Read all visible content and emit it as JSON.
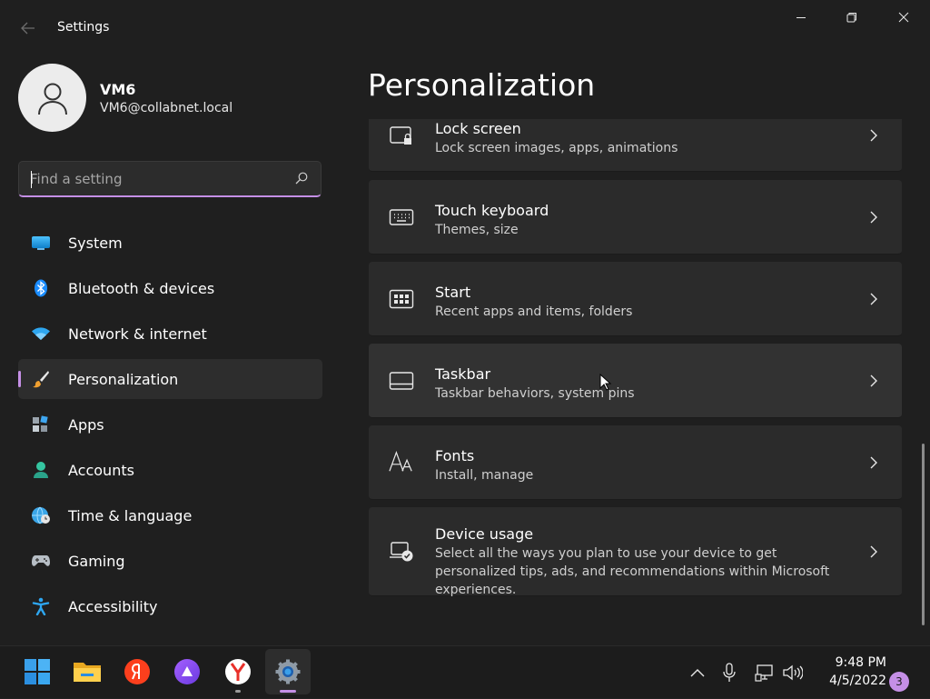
{
  "window": {
    "app_title": "Settings",
    "back_icon": "back-arrow-icon",
    "controls": [
      "minimize-icon",
      "restore-icon",
      "close-icon"
    ]
  },
  "profile": {
    "name": "VM6",
    "email": "VM6@collabnet.local"
  },
  "search": {
    "placeholder": "Find a setting",
    "value": "",
    "accent": "#c58fe6"
  },
  "sidebar": {
    "items": [
      {
        "label": "System",
        "icon": "system-monitor-icon",
        "active": false
      },
      {
        "label": "Bluetooth & devices",
        "icon": "bluetooth-icon",
        "active": false
      },
      {
        "label": "Network & internet",
        "icon": "wifi-icon",
        "active": false
      },
      {
        "label": "Personalization",
        "icon": "paintbrush-icon",
        "active": true
      },
      {
        "label": "Apps",
        "icon": "apps-icon",
        "active": false
      },
      {
        "label": "Accounts",
        "icon": "person-icon",
        "active": false
      },
      {
        "label": "Time & language",
        "icon": "globe-clock-icon",
        "active": false
      },
      {
        "label": "Gaming",
        "icon": "gamepad-icon",
        "active": false
      },
      {
        "label": "Accessibility",
        "icon": "accessibility-icon",
        "active": false
      }
    ]
  },
  "main": {
    "title": "Personalization",
    "cards": [
      {
        "title": "Lock screen",
        "subtitle": "Lock screen images, apps, animations",
        "icon": "lock-screen-icon"
      },
      {
        "title": "Touch keyboard",
        "subtitle": "Themes, size",
        "icon": "keyboard-icon"
      },
      {
        "title": "Start",
        "subtitle": "Recent apps and items, folders",
        "icon": "start-icon"
      },
      {
        "title": "Taskbar",
        "subtitle": "Taskbar behaviors, system pins",
        "icon": "taskbar-icon"
      },
      {
        "title": "Fonts",
        "subtitle": "Install, manage",
        "icon": "fonts-icon"
      },
      {
        "title": "Device usage",
        "subtitle": "Select all the ways you plan to use your device to get personalized tips, ads, and recommendations within Microsoft experiences.",
        "icon": "device-usage-icon"
      }
    ]
  },
  "taskbar": {
    "apps": [
      {
        "name": "start-button",
        "icon": "windows-logo-icon"
      },
      {
        "name": "file-explorer-button",
        "icon": "folder-icon"
      },
      {
        "name": "yandex-button",
        "icon": "yandex-icon"
      },
      {
        "name": "alice-button",
        "icon": "alice-icon"
      },
      {
        "name": "yandex-browser-button",
        "icon": "yandex-browser-icon"
      },
      {
        "name": "settings-button",
        "icon": "gear-icon"
      }
    ],
    "tray_icons": [
      "chevron-up-icon",
      "microphone-icon",
      "network-icon",
      "volume-icon"
    ],
    "time": "9:48 PM",
    "date": "4/5/2022",
    "notification_count": "3"
  }
}
